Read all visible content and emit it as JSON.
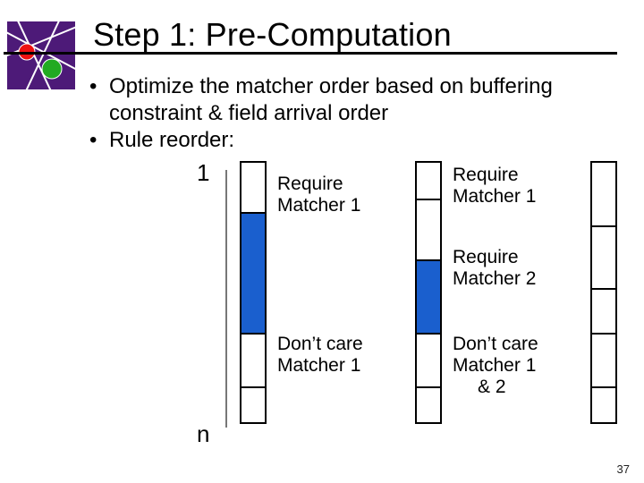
{
  "title": "Step 1: Pre-Computation",
  "bullets": {
    "b1": "Optimize the matcher order based on buffering constraint & field arrival order",
    "b2": "Rule reorder:"
  },
  "axis": {
    "top": "1",
    "bottom": "n"
  },
  "labels": {
    "req1_a": "Require",
    "req1_b": "Matcher 1",
    "dc1_a": "Don’t care",
    "dc1_b": "Matcher 1",
    "req1r_a": "Require",
    "req1r_b": "Matcher 1",
    "req2_a": "Require",
    "req2_b": "Matcher 2",
    "dc12_a": "Don’t care",
    "dc12_b": "Matcher 1",
    "dc12_c": "& 2"
  },
  "page_number": "37"
}
